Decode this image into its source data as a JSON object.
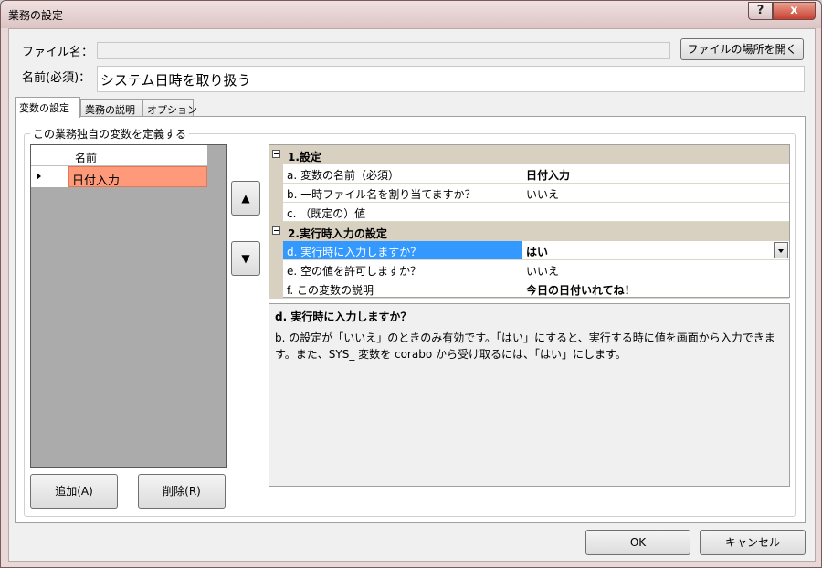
{
  "window": {
    "title": "業務の設定",
    "help_glyph": "?",
    "close_glyph": "x"
  },
  "form": {
    "file_label": "ファイル名：",
    "file_value": "",
    "open_location_button": "ファイルの場所を開く",
    "name_label": "名前(必須)：",
    "name_value": "システム日時を取り扱う"
  },
  "tabs": [
    {
      "label": "変数の設定",
      "active": true
    },
    {
      "label": "業務の説明",
      "active": false
    },
    {
      "label": "オプション",
      "active": false
    }
  ],
  "variables_group": {
    "legend": "この業務独自の変数を定義する",
    "column_header": "名前",
    "rows": [
      "日付入力"
    ],
    "move_up_glyph": "▲",
    "move_down_glyph": "▼",
    "add_button": "追加(A)",
    "delete_button": "削除(R)"
  },
  "property_grid": {
    "categories": [
      {
        "label": "1.設定",
        "rows": [
          {
            "name": "a. 変数の名前（必須）",
            "value": "日付入力",
            "bold": true
          },
          {
            "name": "b. 一時ファイル名を割り当てますか？",
            "value": "いいえ",
            "bold": false
          },
          {
            "name": "c. （既定の）値",
            "value": "",
            "bold": false
          }
        ]
      },
      {
        "label": "2.実行時入力の設定",
        "rows": [
          {
            "name": "d. 実行時に入力しますか？",
            "value": "はい",
            "bold": true,
            "selected": true
          },
          {
            "name": "e. 空の値を許可しますか？",
            "value": "いいえ",
            "bold": false
          },
          {
            "name": "f. この変数の説明",
            "value": "今日の日付いれてね！",
            "bold": true
          }
        ]
      }
    ]
  },
  "description": {
    "title": "d. 実行時に入力しますか？",
    "line1": "b. の設定が「いいえ」のときのみ有効です。「はい」にすると、実行する時に値を画面から入力できま",
    "line2": "す。また、SYS_ 変数を corabo から受け取るには、「はい」にします。"
  },
  "footer": {
    "ok_button": "OK",
    "cancel_button": "キャンセル"
  },
  "colors": {
    "selection": "#3399ff",
    "row_highlight": "#fe9a7a",
    "category_band": "#d8d0c0"
  }
}
